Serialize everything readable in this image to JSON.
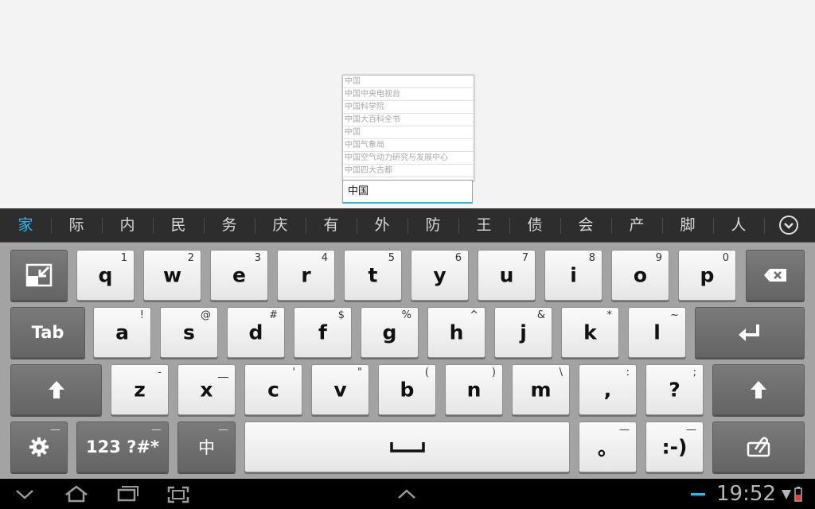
{
  "suggestions": [
    "中国",
    "中国中央电视台",
    "中国科学院",
    "中国大百科全书",
    "中国",
    "中国气象局",
    "中国空气动力研究与发展中心",
    "中国四大古都"
  ],
  "search": {
    "value": "中国"
  },
  "candidates": [
    "家",
    "际",
    "内",
    "民",
    "务",
    "庆",
    "有",
    "外",
    "防",
    "王",
    "债",
    "会",
    "产",
    "脚",
    "人"
  ],
  "keyboard": {
    "row1": [
      {
        "k": "q",
        "h": "1"
      },
      {
        "k": "w",
        "h": "2"
      },
      {
        "k": "e",
        "h": "3"
      },
      {
        "k": "r",
        "h": "4"
      },
      {
        "k": "t",
        "h": "5"
      },
      {
        "k": "y",
        "h": "6"
      },
      {
        "k": "u",
        "h": "7"
      },
      {
        "k": "i",
        "h": "8"
      },
      {
        "k": "o",
        "h": "9"
      },
      {
        "k": "p",
        "h": "0"
      }
    ],
    "row2": [
      {
        "k": "a",
        "h": "!"
      },
      {
        "k": "s",
        "h": "@"
      },
      {
        "k": "d",
        "h": "#"
      },
      {
        "k": "f",
        "h": "$"
      },
      {
        "k": "g",
        "h": "%"
      },
      {
        "k": "h",
        "h": "^"
      },
      {
        "k": "j",
        "h": "&"
      },
      {
        "k": "k",
        "h": "*"
      },
      {
        "k": "l",
        "h": "~"
      }
    ],
    "row3": [
      {
        "k": "z",
        "h": "-"
      },
      {
        "k": "x",
        "h": "__"
      },
      {
        "k": "c",
        "h": "'"
      },
      {
        "k": "v",
        "h": "\""
      },
      {
        "k": "b",
        "h": "("
      },
      {
        "k": "n",
        "h": ")"
      },
      {
        "k": "m",
        "h": "\\"
      },
      {
        "k": ",",
        "h": ":"
      },
      {
        "k": "?",
        "h": ";"
      }
    ],
    "tab_label": "Tab",
    "symbols_label": "123 ?#*",
    "lang_label": "中",
    "period_label": "。",
    "smiley_label": ":-)",
    "bottom_hint": "—"
  },
  "status": {
    "time": "19:52"
  },
  "colors": {
    "accent": "#33b5e5",
    "candidate_bg": "#2d2d2d",
    "keyboard_bg": "#a3a3a3"
  },
  "icons": [
    "hide-keyboard-icon",
    "backspace-icon",
    "enter-icon",
    "shift-icon",
    "settings-gear-icon",
    "clipboard-icon",
    "space-icon",
    "collapse-candidates-icon",
    "back-icon",
    "home-icon",
    "recent-apps-icon",
    "screenshot-icon",
    "notifications-chevron-icon",
    "wifi-icon",
    "battery-icon"
  ]
}
